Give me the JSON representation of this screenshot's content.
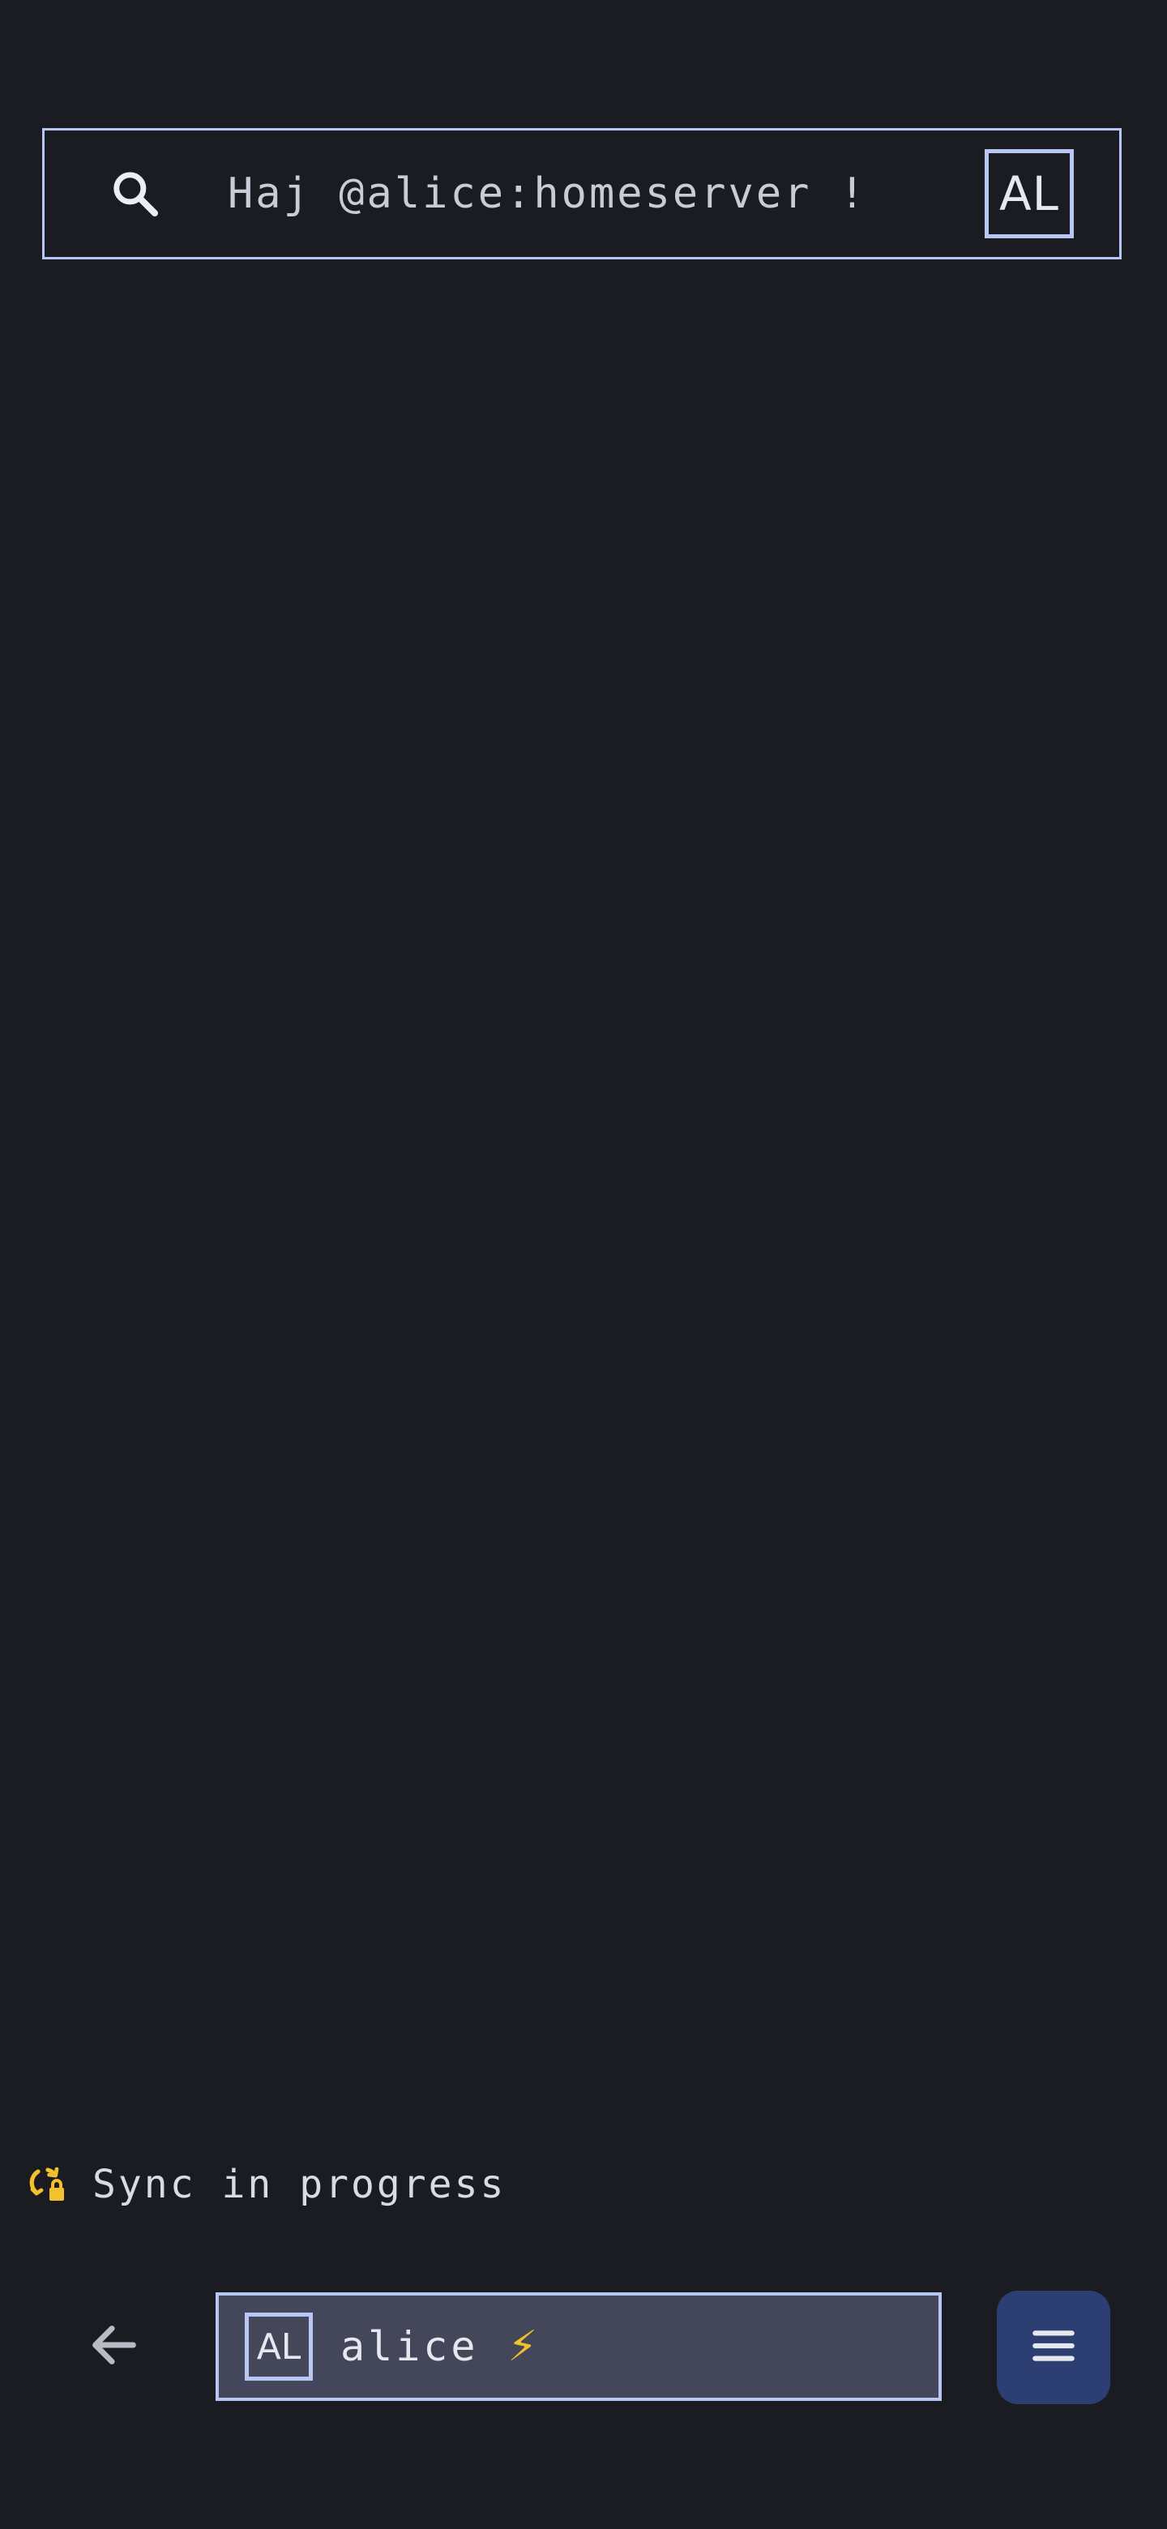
{
  "header": {
    "greeting": "Haj @alice:homeserver !",
    "avatar_initials": "AL",
    "search_icon": "search-icon"
  },
  "status": {
    "sync_text": "Sync in progress",
    "sync_icon": "sync-lock-icon"
  },
  "bottom_bar": {
    "back_icon": "arrow-left-icon",
    "account": {
      "avatar_initials": "AL",
      "name": "alice",
      "badge": "⚡"
    },
    "menu_icon": "hamburger-menu-icon"
  },
  "colors": {
    "background": "#1b1c21",
    "accent_border": "#b7c6f2",
    "chip_background": "#434759",
    "menu_button": "#2d3f72",
    "warning_yellow": "#f3c12b"
  }
}
